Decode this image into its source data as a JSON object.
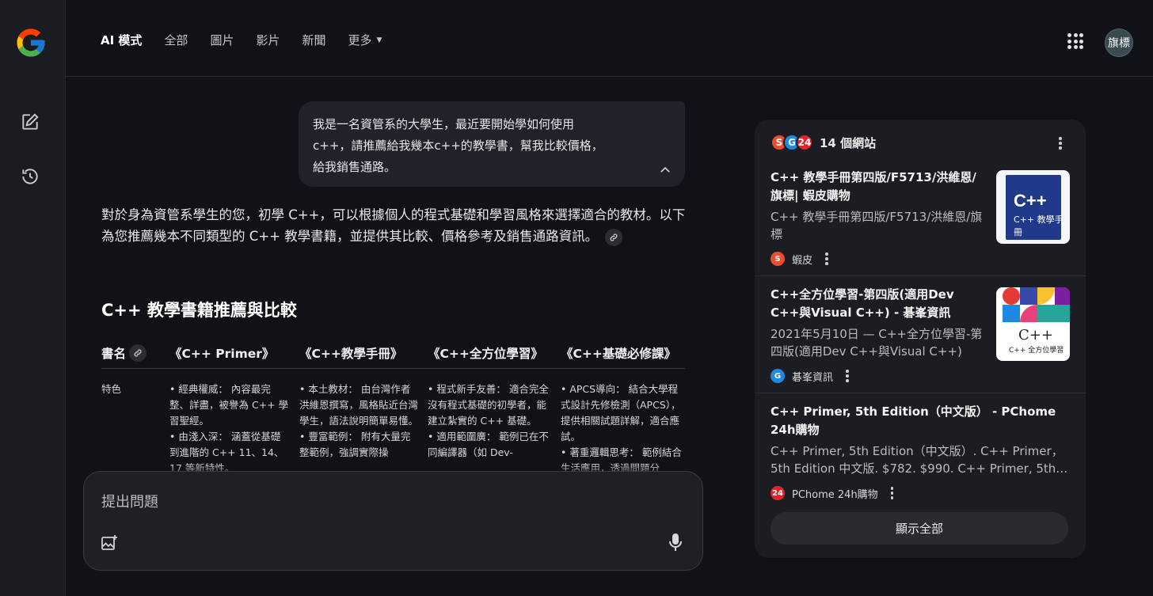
{
  "nav": {
    "tabs": [
      {
        "label": "AI 模式",
        "active": true
      },
      {
        "label": "全部"
      },
      {
        "label": "圖片"
      },
      {
        "label": "影片"
      },
      {
        "label": "新聞"
      },
      {
        "label": "更多"
      }
    ],
    "avatar_text": "旗標"
  },
  "user_query": {
    "line1": "我是一名資管系的大學生，最近要開始學如何使用",
    "line2": "c++，請推薦給我幾本c++的教學書，幫我比較價格，",
    "line3": "給我銷售通路。"
  },
  "answer": {
    "intro": "對於身為資管系學生的您，初學 C++，可以根據個人的程式基礎和學習風格來選擇適合的教材。以下為您推薦幾本不同類型的 C++ 教學書籍，並提供其比較、價格參考及銷售通路資訊。",
    "section_title": "C++ 教學書籍推薦與比較",
    "table": {
      "headers": [
        "書名",
        "《C++ Primer》",
        "《C++教學手冊》",
        "《C++全方位學習》",
        "《C++基礎必修課》"
      ],
      "row_label": "特色",
      "cells": [
        [
          "• 經典權威： 內容最完整、詳盡，被譽為 C++ 學習聖經。",
          "• 由淺入深： 涵蓋從基礎到進階的 C++ 11、14、17 等新特性。"
        ],
        [
          "• 本土教材： 由台灣作者洪維恩撰寫，風格貼近台灣學生，語法說明簡單易懂。",
          "• 豐富範例： 附有大量完整範例，強調實際操"
        ],
        [
          "• 程式新手友善： 適合完全沒有程式基礎的初學者，能建立紮實的 C++ 基礎。",
          "• 適用範圍廣： 範例已在不同編譯器（如 Dev-"
        ],
        [
          "• APCS導向： 結合大學程式設計先修檢測（APCS），提供相關試題詳解，適合應試。",
          "• 著重邏輯思考： 範例結合生活應用，透過問題分"
        ]
      ]
    }
  },
  "composer": {
    "placeholder": "提出問題"
  },
  "sources": {
    "count_label": "14 個網站",
    "items": [
      {
        "title": "C++ 教學手冊第四版/F5713/洪維恩/旗標| 蝦皮購物",
        "snippet": "C++ 教學手冊第四版/F5713/洪維恩/旗標",
        "site": "蝦皮",
        "thumb_text": "C++ 教學手冊"
      },
      {
        "title": "C++全方位學習-第四版(適用Dev C++與Visual C++) - 碁峯資訊",
        "snippet": "2021年5月10日 — C++全方位學習-第四版(適用Dev C++與Visual C++) ......",
        "site": "碁峯資訊",
        "thumb_text": "C++ 全方位學習"
      },
      {
        "title": "C++ Primer, 5th Edition（中文版） - PChome 24h購物",
        "snippet": "C++ Primer, 5th Edition（中文版）. C++ Primer，5th Edition 中文版. $782. $990. C++ Primer, 5th…",
        "site": "PChome 24h購物"
      }
    ],
    "show_all": "顯示全部"
  },
  "colors": {
    "background": "#111217",
    "rail": "#1b1c21",
    "card": "#1c1d22",
    "shopee": "#ee4d2d",
    "gotop": "#1e88e5",
    "pchome": "#e0242a"
  },
  "icons": [
    "google-logo",
    "new-chat-icon",
    "history-icon",
    "apps-grid-icon",
    "collapse-chevron-icon",
    "link-icon",
    "add-image-icon",
    "mic-icon",
    "more-vert-icon"
  ]
}
